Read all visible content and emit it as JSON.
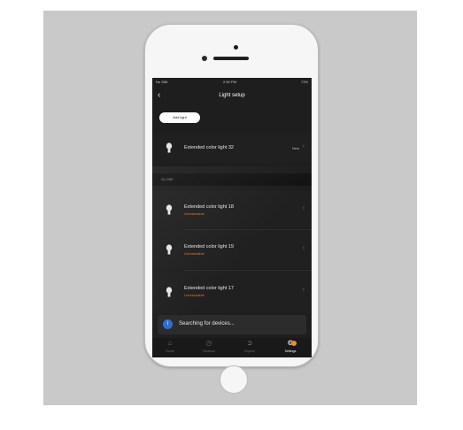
{
  "status_bar": {
    "carrier": "No SIM",
    "time": "2:59 PM",
    "battery": "71%"
  },
  "nav": {
    "back_icon": "chevron-left-icon",
    "title": "Light setup"
  },
  "add_button": {
    "label": "Add light"
  },
  "new_light": {
    "name": "Extended color light 32",
    "badge": "New",
    "icon": "bulb-icon"
  },
  "section": {
    "label": "GLOBE"
  },
  "lights": [
    {
      "name": "Extended color light 18",
      "status": "Unreachable",
      "icon": "bulb-icon"
    },
    {
      "name": "Extended color light 19",
      "status": "Unreachable",
      "icon": "bulb-icon"
    },
    {
      "name": "Extended color light 17",
      "status": "Unreachable",
      "icon": "bulb-icon"
    }
  ],
  "search_bar": {
    "icon": "info-icon",
    "text": "Searching for devices..."
  },
  "tabs": [
    {
      "label": "Home",
      "icon": "home-icon"
    },
    {
      "label": "Routines",
      "icon": "clock-icon"
    },
    {
      "label": "Explore",
      "icon": "compass-icon"
    },
    {
      "label": "Settings",
      "icon": "gear-icon",
      "active": true
    }
  ],
  "colors": {
    "accent": "#f08a24",
    "screen_bg": "#1e1e1e",
    "unreachable": "#e07a2f",
    "info": "#2f6fd4"
  }
}
